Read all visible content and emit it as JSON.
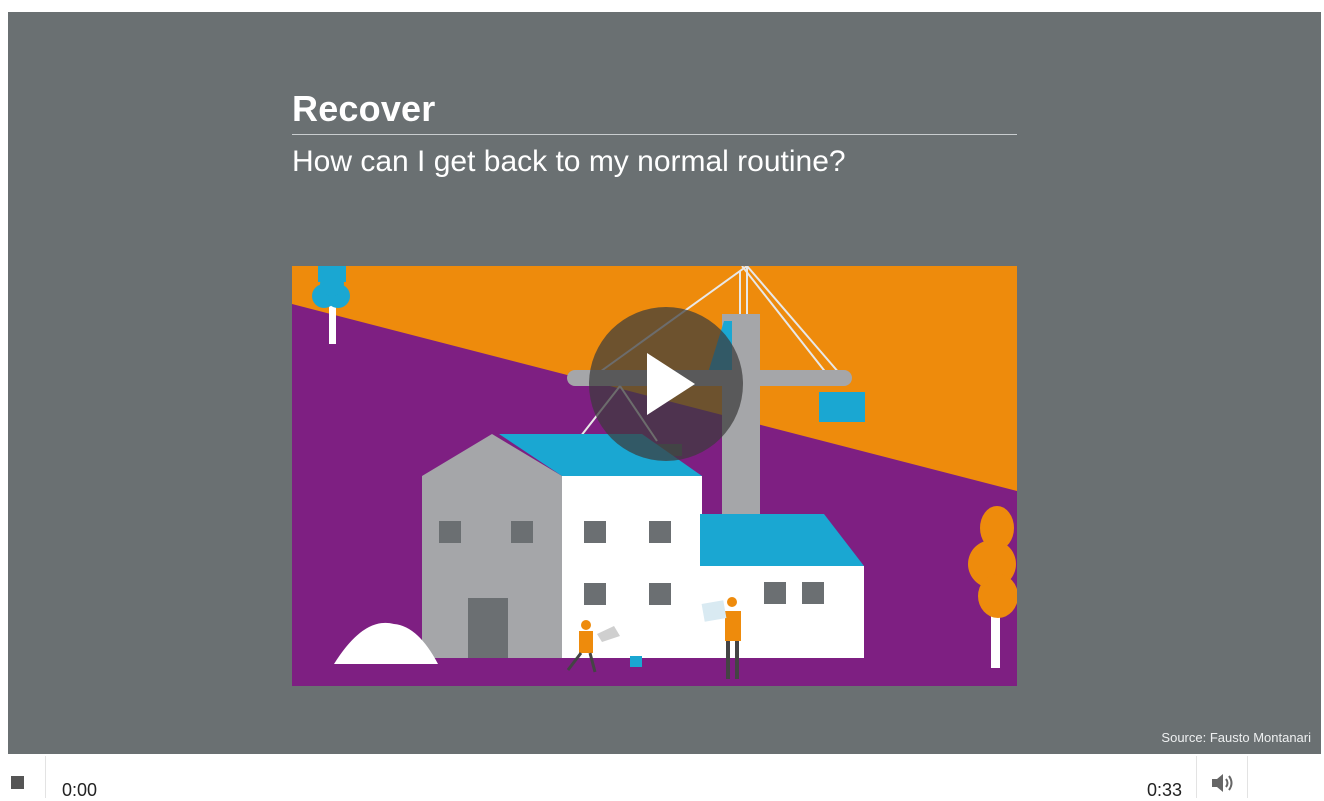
{
  "slide": {
    "title": "Recover",
    "question": "How can I get back to my normal routine?",
    "source": "Source: Fausto Montanari"
  },
  "controls": {
    "current_time": "0:00",
    "duration": "0:33"
  },
  "icons": {
    "play": "play-icon",
    "stop": "stop-icon",
    "volume": "speaker-icon"
  },
  "colors": {
    "frame_background": "#6a7072",
    "orange": "#ee8b0c",
    "purple": "#7e1f82",
    "cyan": "#1aa7d2"
  }
}
